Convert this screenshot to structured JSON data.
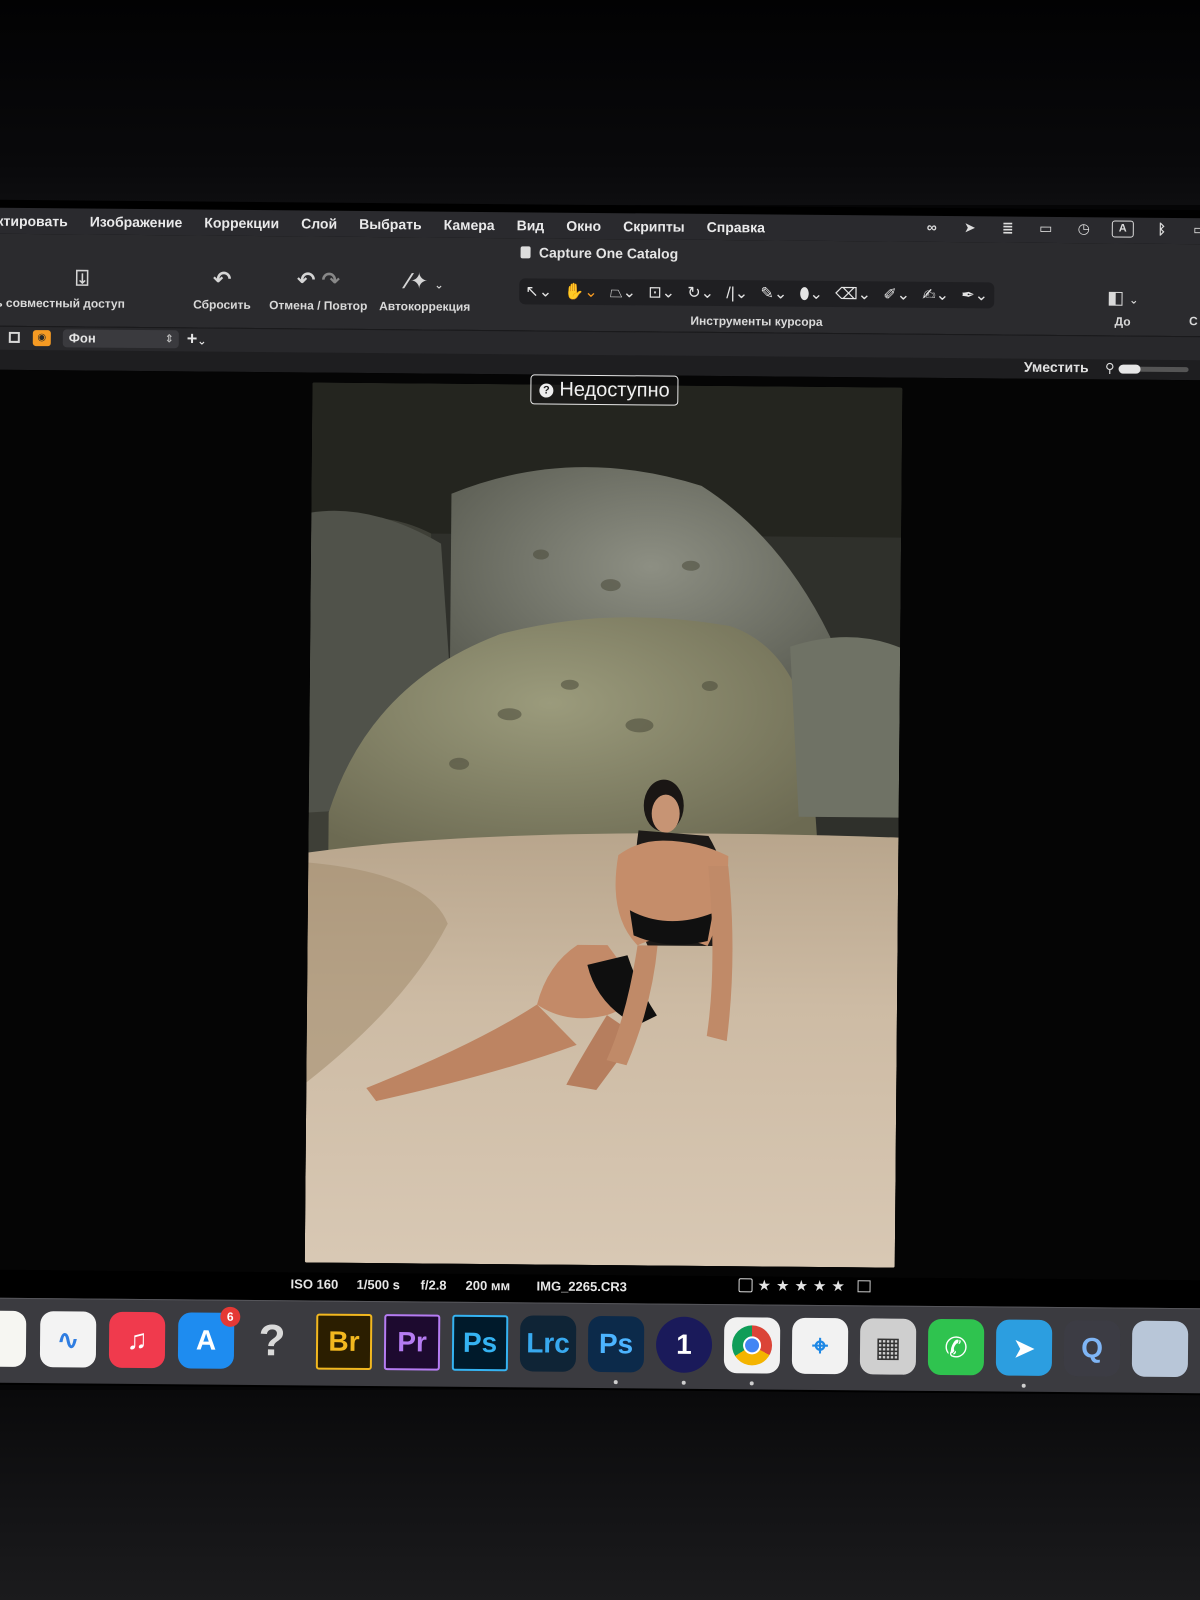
{
  "menubar": {
    "items": [
      "дактировать",
      "Изображение",
      "Коррекции",
      "Слой",
      "Выбрать",
      "Камера",
      "Вид",
      "Окно",
      "Скрипты",
      "Справка"
    ],
    "status_icons": [
      "creative-cloud-icon",
      "location-icon",
      "stack-icon",
      "screen-icon",
      "time-machine-icon",
      "input-source-icon",
      "bluetooth-icon",
      "battery-icon"
    ],
    "input_source": "A"
  },
  "toolbar": {
    "window_title": "Capture One Catalog",
    "share_label": "ыть совместный доступ",
    "reset_label": "Сбросить",
    "undo_redo_label": "Отмена / Повтор",
    "autocorrect_label": "Автокоррекция",
    "cursor_tools_label": "Инструменты курсора",
    "before_label": "До",
    "right_cut_label": "С"
  },
  "layers": {
    "selected_layer": "Фон",
    "add_symbol": "+"
  },
  "viewer": {
    "fit_label": "Уместить",
    "unavailable_label": "Недоступно"
  },
  "image_meta": {
    "iso": "ISO 160",
    "shutter": "1/500 s",
    "aperture": "f/2.8",
    "focal": "200 мм",
    "filename": "IMG_2265.CR3",
    "rating": 0,
    "max_rating": 5
  },
  "dock": {
    "apps": [
      {
        "name": "notes",
        "label": "",
        "bg": "#f6f6f2",
        "fg": "#f5c518"
      },
      {
        "name": "freeform",
        "label": "∿",
        "bg": "#f3f3f3",
        "fg": "#2f7de1"
      },
      {
        "name": "music",
        "label": "♫",
        "bg": "#f03a4d",
        "fg": "#ffffff"
      },
      {
        "name": "app-store",
        "label": "A",
        "bg": "#1e8cf0",
        "fg": "#ffffff",
        "badge": "6"
      },
      {
        "name": "unknown-app",
        "label": "?",
        "bg": "transparent",
        "fg": "#d9d9d9"
      },
      {
        "name": "bridge",
        "label": "Br",
        "bg": "#2b1e00",
        "fg": "#f2b81f"
      },
      {
        "name": "premiere-pro",
        "label": "Pr",
        "bg": "#1d0a2f",
        "fg": "#b57cf2"
      },
      {
        "name": "photoshop",
        "label": "Ps",
        "bg": "#001a2b",
        "fg": "#35b3f2"
      },
      {
        "name": "lightroom-classic",
        "label": "Lrc",
        "bg": "#0f2436",
        "fg": "#38a9ef"
      },
      {
        "name": "photoshop-alt",
        "label": "Ps",
        "bg": "#0c2a4a",
        "fg": "#4cb4ff"
      },
      {
        "name": "capture-one",
        "label": "1",
        "bg": "#1a1a5a",
        "fg": "#ffffff"
      },
      {
        "name": "chrome",
        "label": "",
        "bg": "#f1f1f1",
        "fg": "#db4437"
      },
      {
        "name": "safari",
        "label": "⌖",
        "bg": "#f2f2f2",
        "fg": "#1e88e5"
      },
      {
        "name": "image-capture",
        "label": "▦",
        "bg": "#cfcfcf",
        "fg": "#333333"
      },
      {
        "name": "whatsapp",
        "label": "✆",
        "bg": "#2fc34f",
        "fg": "#ffffff"
      },
      {
        "name": "telegram",
        "label": "➤",
        "bg": "#2c9ee0",
        "fg": "#ffffff"
      },
      {
        "name": "quicktime",
        "label": "Q",
        "bg": "#3c3c44",
        "fg": "#7fb5f5"
      },
      {
        "name": "preview",
        "label": "",
        "bg": "#b8c6d8",
        "fg": "#333333"
      }
    ]
  }
}
